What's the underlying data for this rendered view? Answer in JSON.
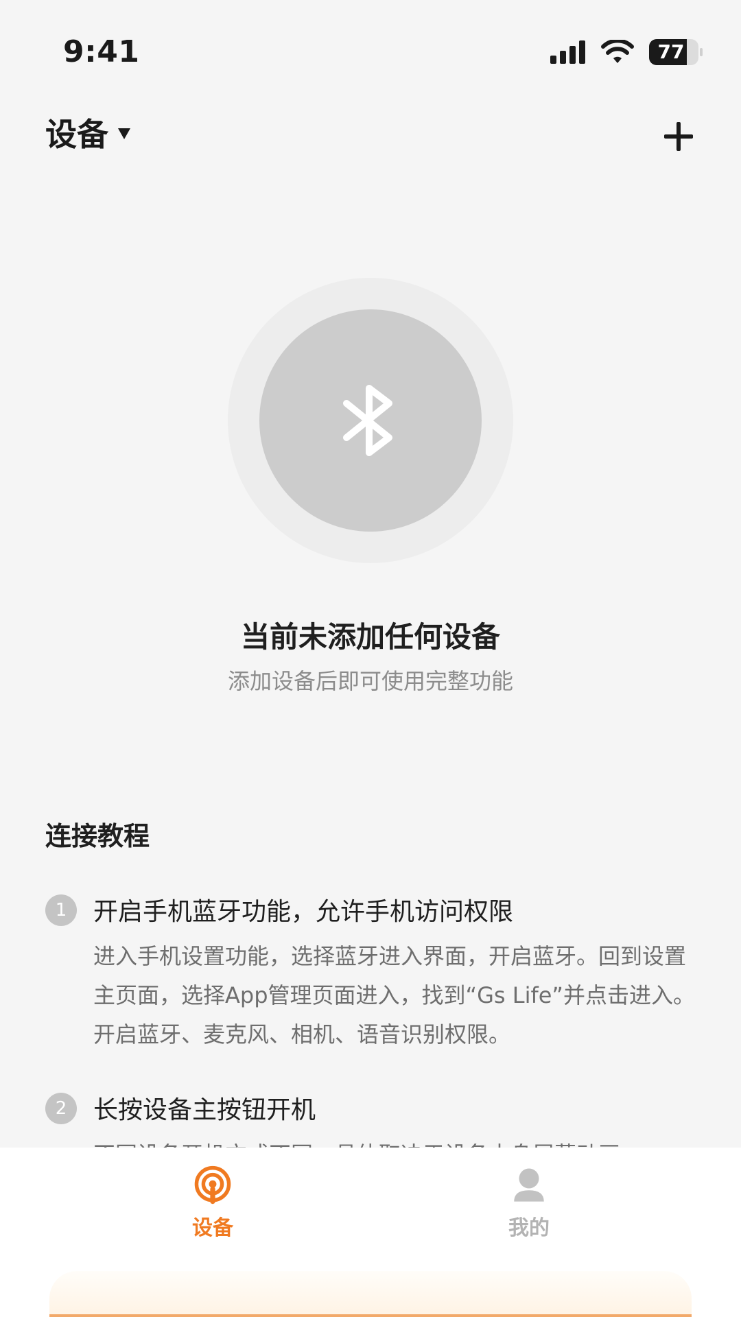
{
  "status_bar": {
    "time": "9:41",
    "battery": "77",
    "icons": [
      "signal-icon",
      "wifi-icon",
      "battery-icon"
    ]
  },
  "header": {
    "title": "设备",
    "icons": [
      "caret-down-icon",
      "plus-icon"
    ]
  },
  "empty_state": {
    "icon": "bluetooth-icon",
    "title": "当前未添加任何设备",
    "subtitle": "添加设备后即可使用完整功能"
  },
  "tutorial": {
    "heading": "连接教程",
    "steps": [
      {
        "number": "1",
        "title": "开启手机蓝牙功能，允许手机访问权限",
        "description": "进入手机设置功能，选择蓝牙进入界面，开启蓝牙。回到设置主页面，选择App管理页面进入，找到“Gs Life”并点击进入。开启蓝牙、麦克风、相机、语音识别权限。"
      },
      {
        "number": "2",
        "title": "长按设备主按钮开机",
        "description": "不同设备开机方式不同，具体取决于设备本身屏幕动画"
      }
    ]
  },
  "tab_bar": {
    "tabs": [
      {
        "label": "设备",
        "icon": "device-signal-icon",
        "active": true
      },
      {
        "label": "我的",
        "icon": "person-icon",
        "active": false
      }
    ]
  },
  "colors": {
    "accent": "#f07a21",
    "background": "#f5f5f5",
    "inactive": "#b3b3b3"
  }
}
